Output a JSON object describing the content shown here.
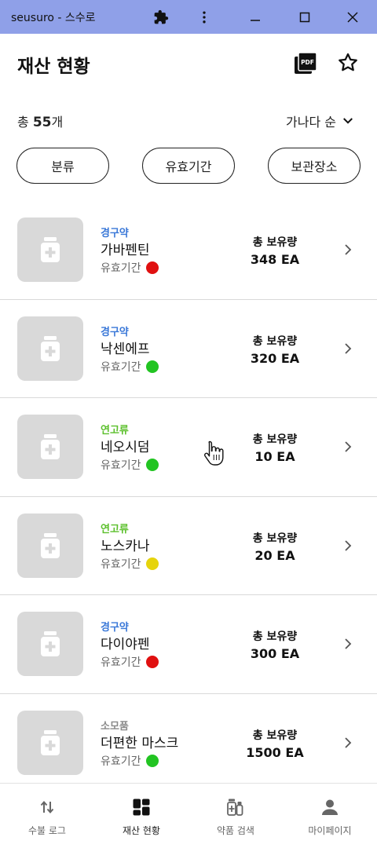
{
  "window": {
    "title": "seusuro - 스수로",
    "icons": [
      "puzzle-icon",
      "more-vertical-icon",
      "minimize-icon",
      "maximize-icon",
      "close-icon"
    ]
  },
  "header": {
    "title": "재산 현황",
    "icons": [
      "pdf-icon",
      "star-icon"
    ]
  },
  "summary": {
    "count_prefix": "총",
    "count_value": "55",
    "count_suffix": "개",
    "sort_label": "가나다 순"
  },
  "filters": [
    "분류",
    "유효기간",
    "보관장소"
  ],
  "items": [
    {
      "category": "경구약",
      "category_color": "#3a78d8",
      "name": "가바펜틴",
      "expiry_label": "유효기간",
      "status_color": "#e01010",
      "qty_label": "총 보유량",
      "qty_value": "348 EA"
    },
    {
      "category": "경구약",
      "category_color": "#3a78d8",
      "name": "낙센에프",
      "expiry_label": "유효기간",
      "status_color": "#22c422",
      "qty_label": "총 보유량",
      "qty_value": "320 EA"
    },
    {
      "category": "연고류",
      "category_color": "#5cc02c",
      "name": "네오시덤",
      "expiry_label": "유효기간",
      "status_color": "#22c422",
      "qty_label": "총 보유량",
      "qty_value": "10 EA"
    },
    {
      "category": "연고류",
      "category_color": "#5cc02c",
      "name": "노스카나",
      "expiry_label": "유효기간",
      "status_color": "#e6d40c",
      "qty_label": "총 보유량",
      "qty_value": "20 EA"
    },
    {
      "category": "경구약",
      "category_color": "#3a78d8",
      "name": "다이야펜",
      "expiry_label": "유효기간",
      "status_color": "#e01010",
      "qty_label": "총 보유량",
      "qty_value": "300 EA"
    },
    {
      "category": "소모품",
      "category_color": "#8a8a8a",
      "name": "더편한 마스크",
      "expiry_label": "유효기간",
      "status_color": "#22c422",
      "qty_label": "총 보유량",
      "qty_value": "1500 EA"
    }
  ],
  "bottom_nav": [
    {
      "label": "수불 로그",
      "icon": "swap-vertical-icon",
      "active": false
    },
    {
      "label": "재산 현황",
      "icon": "dashboard-icon",
      "active": true
    },
    {
      "label": "약품 검색",
      "icon": "medicine-icon",
      "active": false
    },
    {
      "label": "마이페이지",
      "icon": "person-icon",
      "active": false
    }
  ]
}
